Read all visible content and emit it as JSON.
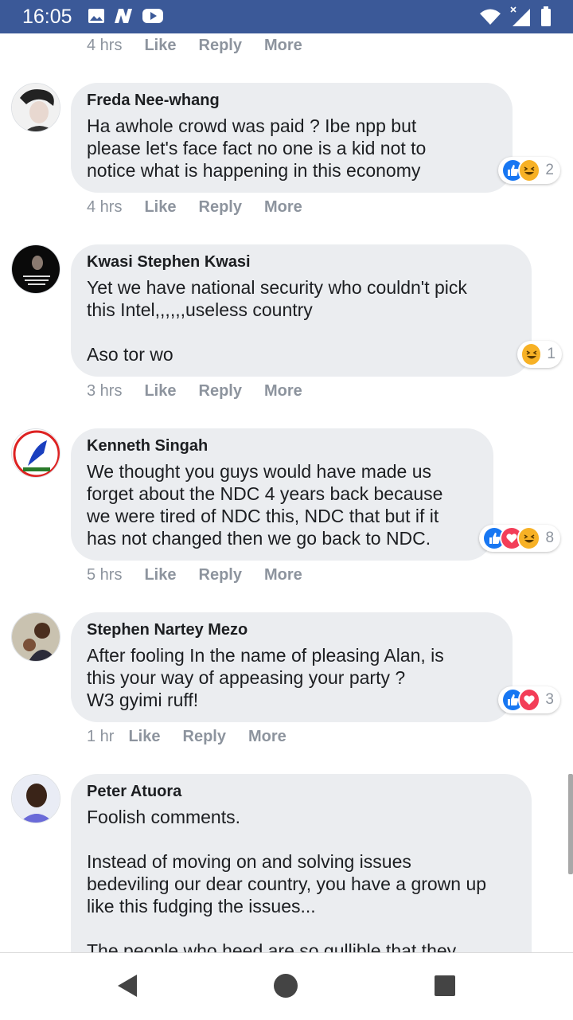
{
  "status_bar": {
    "time": "16:05",
    "icons": [
      "image-icon",
      "n-notification-icon",
      "youtube-icon",
      "wifi-icon",
      "signal-icon",
      "battery-icon"
    ]
  },
  "colors": {
    "status_bar": "#3b5998",
    "bubble": "#ebedf0",
    "meta_text": "#8d949e",
    "like_blue": "#1877f2",
    "love_red": "#f33e58",
    "haha_yellow": "#f7b125"
  },
  "top_meta": {
    "time": "4 hrs",
    "like": "Like",
    "reply": "Reply",
    "more": "More"
  },
  "comments": [
    {
      "author": "Freda Nee-whang",
      "text": "Ha awhole crowd was paid ? Ibe npp but\nplease let's face fact no one is a kid not to\nnotice what is happening in this economy",
      "reactions": [
        "like",
        "haha"
      ],
      "reaction_count": "2",
      "time": "4 hrs",
      "like": "Like",
      "reply": "Reply",
      "more": "More"
    },
    {
      "author": "Kwasi Stephen Kwasi",
      "text": "Yet we have national security who couldn't pick\nthis Intel,,,,,,useless country\n\nAso tor wo",
      "reactions": [
        "haha"
      ],
      "reaction_count": "1",
      "time": "3 hrs",
      "like": "Like",
      "reply": "Reply",
      "more": "More"
    },
    {
      "author": "Kenneth Singah",
      "text": "We thought you guys would have made us\nforget about the NDC 4 years back because\nwe were tired of NDC this, NDC that but if it\nhas not changed then we go back to NDC.",
      "reactions": [
        "like",
        "love",
        "haha"
      ],
      "reaction_count": "8",
      "time": "5 hrs",
      "like": "Like",
      "reply": "Reply",
      "more": "More"
    },
    {
      "author": "Stephen Nartey Mezo",
      "text": "After fooling In the name of pleasing Alan, is\nthis your way of appeasing your party ?\nW3 gyimi ruff!",
      "reactions": [
        "like",
        "love"
      ],
      "reaction_count": "3",
      "time": "1 hr",
      "like": "Like",
      "reply": "Reply",
      "more": "More"
    },
    {
      "author": "Peter Atuora",
      "text": "Foolish comments.\n\nInstead of moving on and solving issues\nbedeviling our dear country, you have a grown up\nlike this fudging the issues...\n\nThe people who heed are so gullible that they"
    }
  ],
  "nav": [
    "back-icon",
    "home-icon",
    "recents-icon"
  ]
}
